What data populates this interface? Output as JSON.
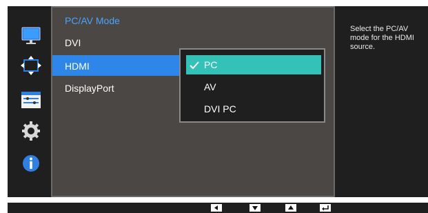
{
  "menu": {
    "title": "PC/AV Mode",
    "items": [
      {
        "label": "DVI"
      },
      {
        "label": "HDMI"
      },
      {
        "label": "DisplayPort"
      }
    ]
  },
  "submenu": {
    "options": [
      {
        "label": "PC",
        "selected": true
      },
      {
        "label": "AV",
        "selected": false
      },
      {
        "label": "DVI PC",
        "selected": false
      }
    ]
  },
  "help": {
    "text": "Select the PC/AV mode for the HDMI source."
  },
  "icons": {
    "side": [
      "picture-icon",
      "position-icon",
      "settings-icon",
      "gear-icon",
      "info-icon"
    ],
    "nav": [
      "left-arrow-icon",
      "down-arrow-icon",
      "up-arrow-icon",
      "enter-icon"
    ]
  },
  "colors": {
    "accent_blue": "#2e86e8",
    "selected_teal": "#33c1b8",
    "title_blue": "#4aa3ff"
  }
}
